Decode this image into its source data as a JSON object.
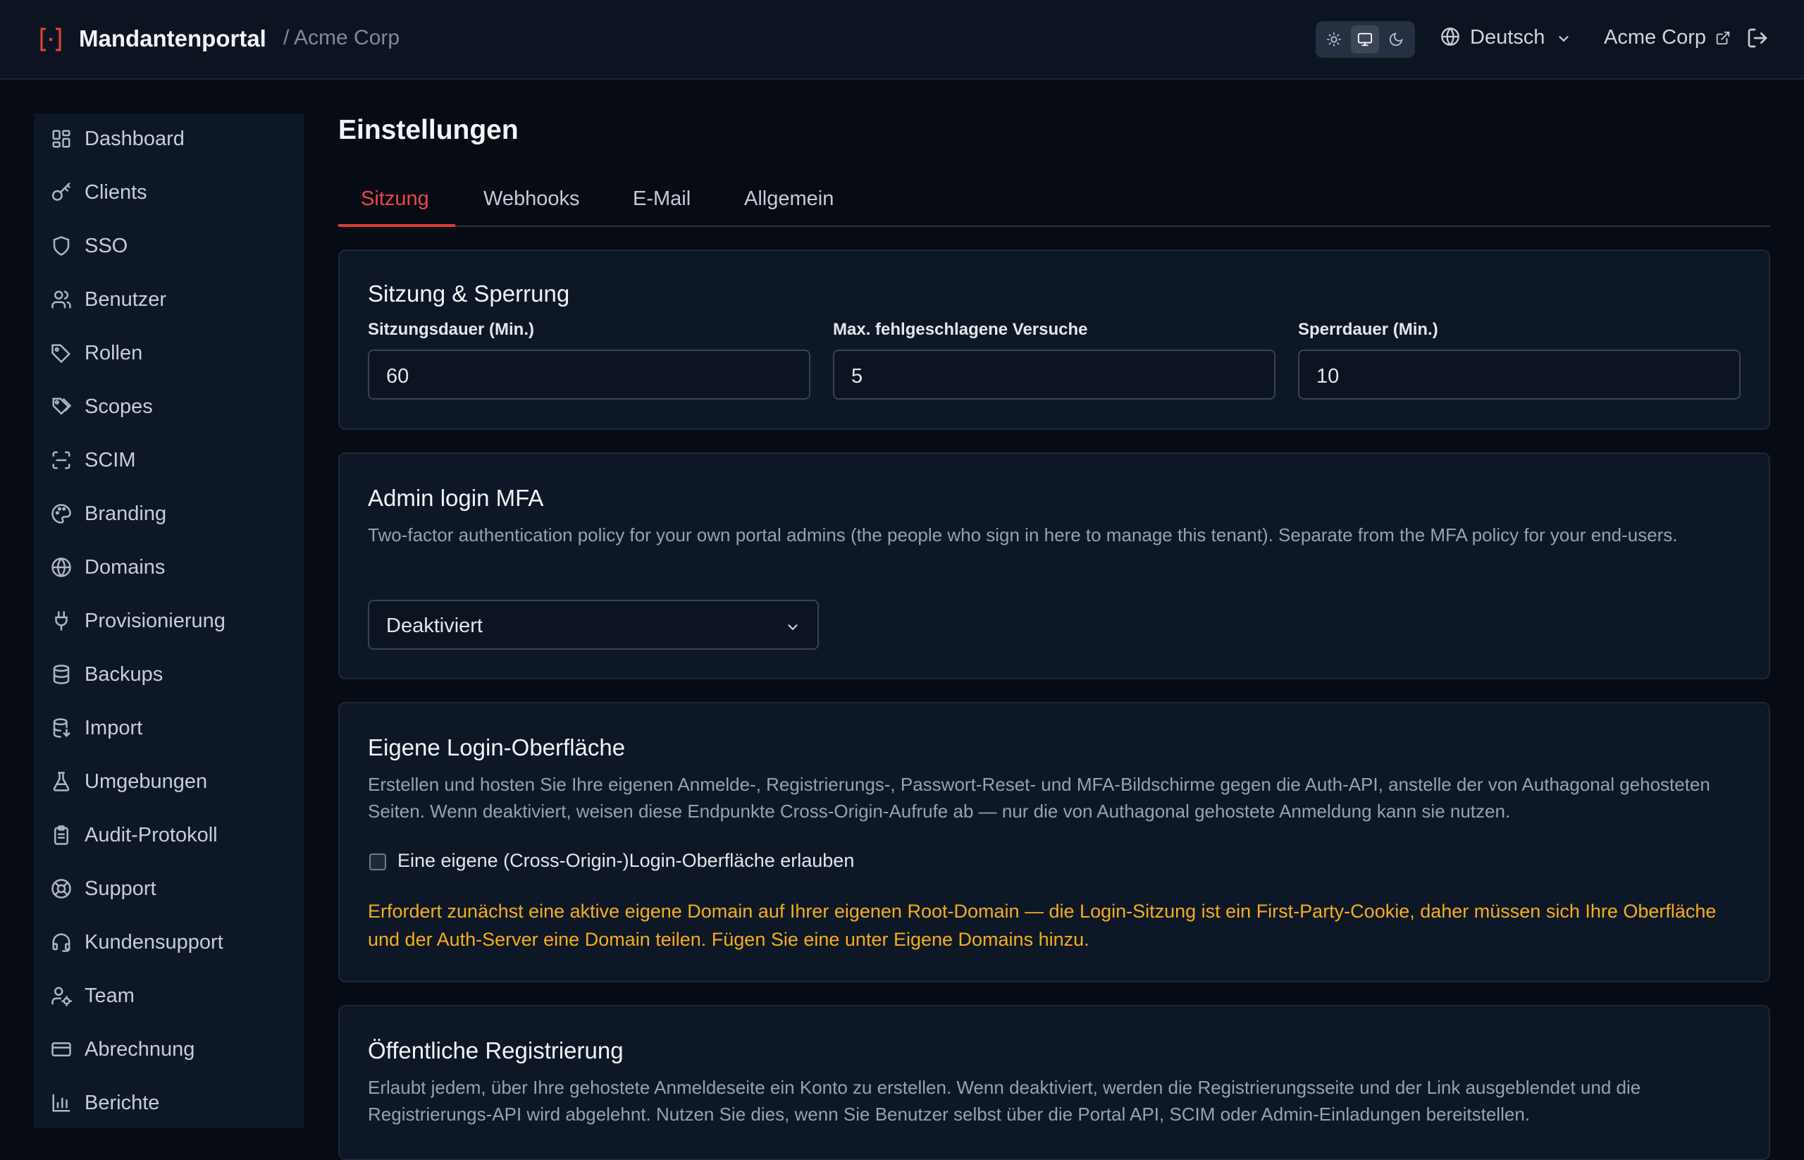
{
  "header": {
    "app_title": "Mandantenportal",
    "breadcrumb": "/ Acme Corp",
    "theme_options": [
      "light-theme",
      "system-theme",
      "dark-theme"
    ],
    "theme_selected": "system-theme",
    "language": "Deutsch",
    "tenant_link": "Acme Corp",
    "logo_icon": "brand-bracket-icon",
    "logout_icon": "logout-icon"
  },
  "sidebar": {
    "items": [
      {
        "label": "Dashboard",
        "icon": "dashboard-icon"
      },
      {
        "label": "Clients",
        "icon": "key-icon"
      },
      {
        "label": "SSO",
        "icon": "shield-icon"
      },
      {
        "label": "Benutzer",
        "icon": "users-icon"
      },
      {
        "label": "Rollen",
        "icon": "tag-icon"
      },
      {
        "label": "Scopes",
        "icon": "tags-icon"
      },
      {
        "label": "SCIM",
        "icon": "scan-icon"
      },
      {
        "label": "Branding",
        "icon": "palette-icon"
      },
      {
        "label": "Domains",
        "icon": "globe-icon"
      },
      {
        "label": "Provisionierung",
        "icon": "plug-icon"
      },
      {
        "label": "Backups",
        "icon": "database-icon"
      },
      {
        "label": "Import",
        "icon": "database-import-icon"
      },
      {
        "label": "Umgebungen",
        "icon": "flask-icon"
      },
      {
        "label": "Audit-Protokoll",
        "icon": "clipboard-icon"
      },
      {
        "label": "Support",
        "icon": "lifebuoy-icon"
      },
      {
        "label": "Kundensupport",
        "icon": "headset-icon"
      },
      {
        "label": "Team",
        "icon": "user-cog-icon"
      },
      {
        "label": "Abrechnung",
        "icon": "credit-card-icon"
      },
      {
        "label": "Berichte",
        "icon": "bar-chart-icon"
      }
    ]
  },
  "main": {
    "title": "Einstellungen",
    "tabs": [
      "Sitzung",
      "Webhooks",
      "E-Mail",
      "Allgemein"
    ],
    "active_tab": "Sitzung",
    "session": {
      "title": "Sitzung & Sperrung",
      "fields": [
        {
          "label": "Sitzungsdauer (Min.)",
          "value": "60"
        },
        {
          "label": "Max. fehlgeschlagene Versuche",
          "value": "5"
        },
        {
          "label": "Sperrdauer (Min.)",
          "value": "10"
        }
      ]
    },
    "mfa": {
      "title": "Admin login MFA",
      "description": "Two-factor authentication policy for your own portal admins (the people who sign in here to manage this tenant). Separate from the MFA policy for your end-users.",
      "selected": "Deaktiviert"
    },
    "custom_login": {
      "title": "Eigene Login-Oberfläche",
      "description": "Erstellen und hosten Sie Ihre eigenen Anmelde-, Registrierungs-, Passwort-Reset- und MFA-Bildschirme gegen die Auth-API, anstelle der von Authagonal gehosteten Seiten. Wenn deaktiviert, weisen diese Endpunkte Cross-Origin-Aufrufe ab — nur die von Authagonal gehostete Anmeldung kann sie nutzen.",
      "checkbox_label": "Eine eigene (Cross-Origin-)Login-Oberfläche erlauben",
      "checked": false,
      "warning": "Erfordert zunächst eine aktive eigene Domain auf Ihrer eigenen Root-Domain — die Login-Sitzung ist ein First-Party-Cookie, daher müssen sich Ihre Oberfläche und der Auth-Server eine Domain teilen. Fügen Sie eine unter Eigene Domains hinzu."
    },
    "registration": {
      "title": "Öffentliche Registrierung",
      "description": "Erlaubt jedem, über Ihre gehostete Anmeldeseite ein Konto zu erstellen. Wenn deaktiviert, werden die Registrierungsseite und der Link ausgeblendet und die Registrierungs-API wird abgelehnt. Nutzen Sie dies, wenn Sie Benutzer selbst über die Portal API, SCIM oder Admin-Einladungen bereitstellen."
    },
    "colors": {
      "accent": "#ef4444",
      "warning": "#f5ae1a",
      "background": "#060b14",
      "surface": "#0e1726"
    }
  }
}
